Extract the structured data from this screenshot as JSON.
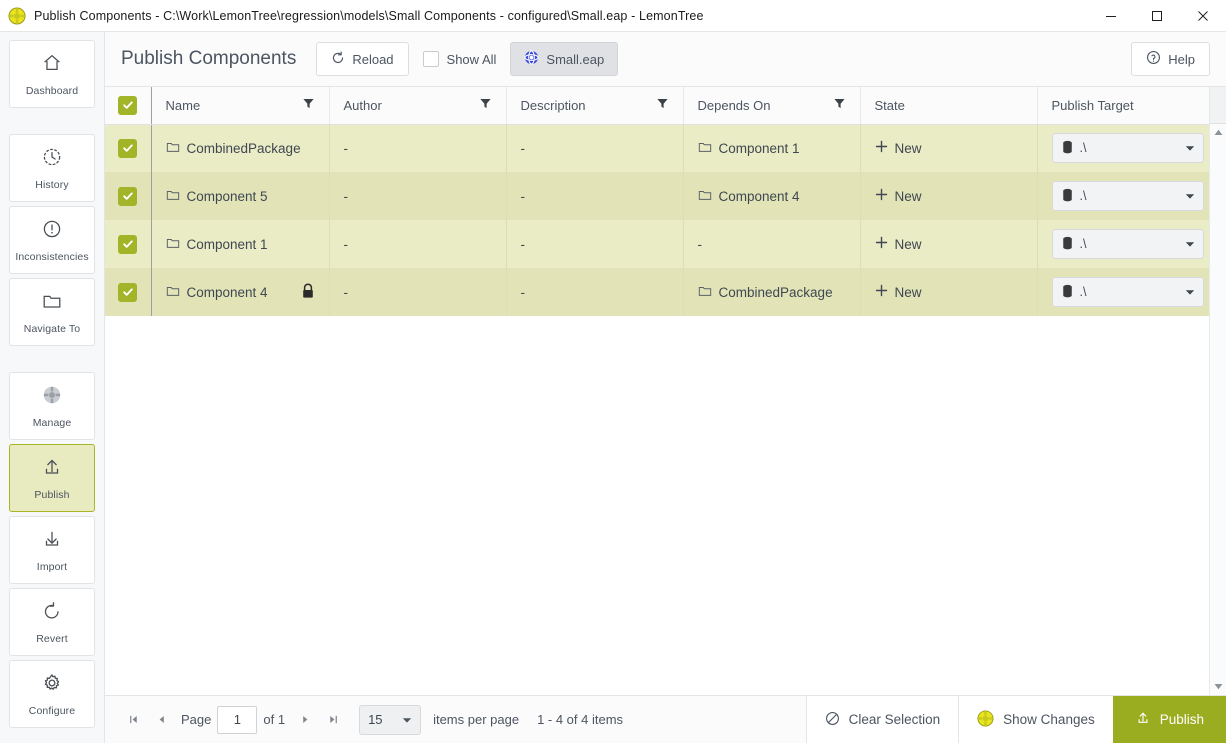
{
  "window": {
    "title": "Publish Components - C:\\Work\\LemonTree\\regression\\models\\Small Components - configured\\Small.eap - LemonTree",
    "logo_icon": "lemon-app-icon",
    "minimize_icon": "minimize-icon",
    "maximize_icon": "maximize-icon",
    "close_icon": "close-icon"
  },
  "sidebar": {
    "items": [
      {
        "label": "Dashboard",
        "icon": "home-icon",
        "active": false
      },
      {
        "label": "History",
        "icon": "clock-icon",
        "active": false
      },
      {
        "label": "Inconsistencies",
        "icon": "alert-circle-icon",
        "active": false
      },
      {
        "label": "Navigate To",
        "icon": "folder-icon",
        "active": false
      },
      {
        "label": "Manage",
        "icon": "lemon-gray-icon",
        "active": false
      },
      {
        "label": "Publish",
        "icon": "upload-icon",
        "active": true
      },
      {
        "label": "Import",
        "icon": "download-icon",
        "active": false
      },
      {
        "label": "Revert",
        "icon": "undo-icon",
        "active": false
      },
      {
        "label": "Configure",
        "icon": "gear-icon",
        "active": false
      }
    ]
  },
  "toolbar": {
    "page_title": "Publish Components",
    "reload_label": "Reload",
    "reload_icon": "refresh-icon",
    "show_all_label": "Show All",
    "show_all_checked": false,
    "file_tab_label": "Small.eap",
    "file_tab_icon": "eap-model-icon",
    "help_label": "Help",
    "help_icon": "question-circle-icon"
  },
  "grid": {
    "select_all_checked": true,
    "columns": [
      {
        "key": "name",
        "label": "Name",
        "filterable": true
      },
      {
        "key": "author",
        "label": "Author",
        "filterable": true
      },
      {
        "key": "desc",
        "label": "Description",
        "filterable": true
      },
      {
        "key": "depends",
        "label": "Depends On",
        "filterable": true
      },
      {
        "key": "state",
        "label": "State",
        "filterable": false
      },
      {
        "key": "target",
        "label": "Publish Target",
        "filterable": false
      }
    ],
    "rows": [
      {
        "checked": true,
        "name": "CombinedPackage",
        "name_icon": "folder-icon",
        "locked": false,
        "author": "-",
        "desc": "-",
        "depends": "Component 1",
        "depends_icon": "folder-icon",
        "state": "New",
        "state_icon": "plus-icon",
        "target": ".\\",
        "target_icon": "database-icon"
      },
      {
        "checked": true,
        "name": "Component 5",
        "name_icon": "folder-icon",
        "locked": false,
        "author": "-",
        "desc": "-",
        "depends": "Component 4",
        "depends_icon": "folder-icon",
        "state": "New",
        "state_icon": "plus-icon",
        "target": ".\\",
        "target_icon": "database-icon"
      },
      {
        "checked": true,
        "name": "Component 1",
        "name_icon": "folder-icon",
        "locked": false,
        "author": "-",
        "desc": "-",
        "depends": "-",
        "depends_icon": "",
        "state": "New",
        "state_icon": "plus-icon",
        "target": ".\\",
        "target_icon": "database-icon"
      },
      {
        "checked": true,
        "name": "Component 4",
        "name_icon": "folder-icon",
        "locked": true,
        "author": "-",
        "desc": "-",
        "depends": "CombinedPackage",
        "depends_icon": "folder-icon",
        "state": "New",
        "state_icon": "plus-icon",
        "target": ".\\",
        "target_icon": "database-icon"
      }
    ]
  },
  "pager": {
    "first_icon": "first-page-icon",
    "prev_icon": "prev-page-icon",
    "next_icon": "next-page-icon",
    "last_icon": "last-page-icon",
    "page_label": "Page",
    "page_value": "1",
    "of_label": "of 1",
    "per_page_value": "15",
    "per_page_label": "items per page",
    "range_label": "1 - 4 of 4 items"
  },
  "footer_actions": {
    "clear_selection_label": "Clear Selection",
    "clear_selection_icon": "no-entry-icon",
    "show_changes_label": "Show Changes",
    "show_changes_icon": "lemon-app-icon",
    "publish_label": "Publish",
    "publish_icon": "upload-icon"
  },
  "colors": {
    "accent": "#9aad21",
    "row_odd": "#eaecc6",
    "row_even": "#e2e4b8",
    "checkbox": "#a2b427",
    "active_sidebar": "#e8eac0"
  }
}
